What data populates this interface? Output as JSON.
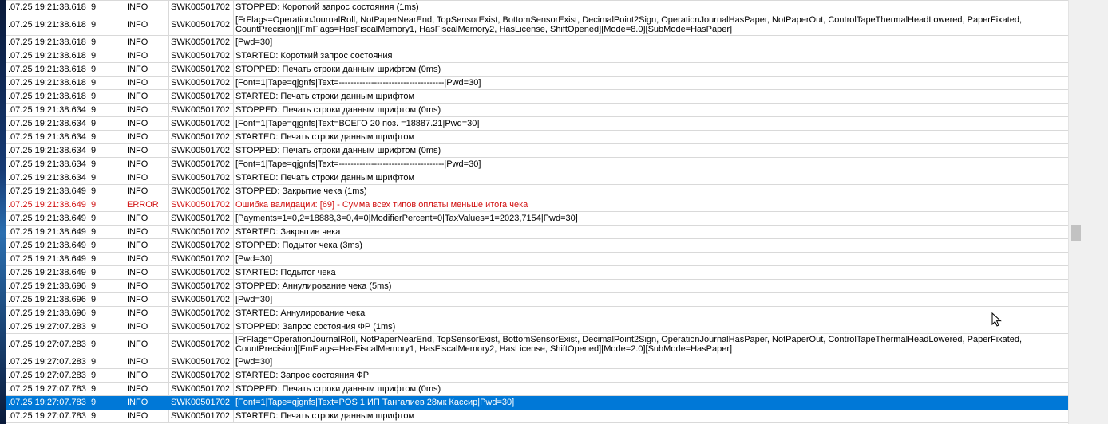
{
  "scroll": {
    "position_fraction": 0.55
  },
  "rows": [
    {
      "time": ".07.25 19:21:38.618",
      "thread": "9",
      "level": "INFO",
      "source": "SWK00501702",
      "message": "STOPPED: Короткий запрос состояния (1ms)"
    },
    {
      "time": ".07.25 19:21:38.618",
      "thread": "9",
      "level": "INFO",
      "source": "SWK00501702",
      "message": "[FrFlags=OperationJournalRoll, NotPaperNearEnd, TopSensorExist, BottomSensorExist, DecimalPoint2Sign, OperationJournalHasPaper, NotPaperOut, ControlTapeThermalHeadLowered, PaperFixated, CountPrecision][FmFlags=HasFiscalMemory1, HasFiscalMemory2, HasLicense, ShiftOpened][Mode=8.0][SubMode=HasPaper]",
      "tall": true
    },
    {
      "time": ".07.25 19:21:38.618",
      "thread": "9",
      "level": "INFO",
      "source": "SWK00501702",
      "message": "[Pwd=30]"
    },
    {
      "time": ".07.25 19:21:38.618",
      "thread": "9",
      "level": "INFO",
      "source": "SWK00501702",
      "message": "STARTED: Короткий запрос состояния"
    },
    {
      "time": ".07.25 19:21:38.618",
      "thread": "9",
      "level": "INFO",
      "source": "SWK00501702",
      "message": "STOPPED: Печать строки данным шрифтом (0ms)"
    },
    {
      "time": ".07.25 19:21:38.618",
      "thread": "9",
      "level": "INFO",
      "source": "SWK00501702",
      "message": "[Font=1|Tape=qjgnfs|Text=------------------------------------|Pwd=30]"
    },
    {
      "time": ".07.25 19:21:38.618",
      "thread": "9",
      "level": "INFO",
      "source": "SWK00501702",
      "message": "STARTED: Печать строки данным шрифтом"
    },
    {
      "time": ".07.25 19:21:38.634",
      "thread": "9",
      "level": "INFO",
      "source": "SWK00501702",
      "message": "STOPPED: Печать строки данным шрифтом (0ms)"
    },
    {
      "time": ".07.25 19:21:38.634",
      "thread": "9",
      "level": "INFO",
      "source": "SWK00501702",
      "message": "[Font=1|Tape=qjgnfs|Text=ВСЕГО 20 поз.            =18887.21|Pwd=30]"
    },
    {
      "time": ".07.25 19:21:38.634",
      "thread": "9",
      "level": "INFO",
      "source": "SWK00501702",
      "message": "STARTED: Печать строки данным шрифтом"
    },
    {
      "time": ".07.25 19:21:38.634",
      "thread": "9",
      "level": "INFO",
      "source": "SWK00501702",
      "message": "STOPPED: Печать строки данным шрифтом (0ms)"
    },
    {
      "time": ".07.25 19:21:38.634",
      "thread": "9",
      "level": "INFO",
      "source": "SWK00501702",
      "message": "[Font=1|Tape=qjgnfs|Text=------------------------------------|Pwd=30]"
    },
    {
      "time": ".07.25 19:21:38.634",
      "thread": "9",
      "level": "INFO",
      "source": "SWK00501702",
      "message": "STARTED: Печать строки данным шрифтом"
    },
    {
      "time": ".07.25 19:21:38.649",
      "thread": "9",
      "level": "INFO",
      "source": "SWK00501702",
      "message": "STOPPED: Закрытие чека (1ms)"
    },
    {
      "time": ".07.25 19:21:38.649",
      "thread": "9",
      "level": "ERROR",
      "source": "SWK00501702",
      "message": "Ошибка валидации: [69] - Сумма всех типов оплаты меньше итога чека",
      "error": true
    },
    {
      "time": ".07.25 19:21:38.649",
      "thread": "9",
      "level": "INFO",
      "source": "SWK00501702",
      "message": "[Payments=1=0,2=18888,3=0,4=0|ModifierPercent=0|TaxValues=1=2023,7154|Pwd=30]"
    },
    {
      "time": ".07.25 19:21:38.649",
      "thread": "9",
      "level": "INFO",
      "source": "SWK00501702",
      "message": "STARTED: Закрытие чека"
    },
    {
      "time": ".07.25 19:21:38.649",
      "thread": "9",
      "level": "INFO",
      "source": "SWK00501702",
      "message": "STOPPED: Подытог чека (3ms)"
    },
    {
      "time": ".07.25 19:21:38.649",
      "thread": "9",
      "level": "INFO",
      "source": "SWK00501702",
      "message": "[Pwd=30]"
    },
    {
      "time": ".07.25 19:21:38.649",
      "thread": "9",
      "level": "INFO",
      "source": "SWK00501702",
      "message": "STARTED: Подытог чека"
    },
    {
      "time": ".07.25 19:21:38.696",
      "thread": "9",
      "level": "INFO",
      "source": "SWK00501702",
      "message": "STOPPED: Аннулирование чека (5ms)"
    },
    {
      "time": ".07.25 19:21:38.696",
      "thread": "9",
      "level": "INFO",
      "source": "SWK00501702",
      "message": "[Pwd=30]"
    },
    {
      "time": ".07.25 19:21:38.696",
      "thread": "9",
      "level": "INFO",
      "source": "SWK00501702",
      "message": "STARTED: Аннулирование чека"
    },
    {
      "time": ".07.25 19:27:07.283",
      "thread": "9",
      "level": "INFO",
      "source": "SWK00501702",
      "message": "STOPPED: Запрос состояния ФР (1ms)"
    },
    {
      "time": ".07.25 19:27:07.283",
      "thread": "9",
      "level": "INFO",
      "source": "SWK00501702",
      "message": "[FrFlags=OperationJournalRoll, NotPaperNearEnd, TopSensorExist, BottomSensorExist, DecimalPoint2Sign, OperationJournalHasPaper, NotPaperOut, ControlTapeThermalHeadLowered, PaperFixated, CountPrecision][FmFlags=HasFiscalMemory1, HasFiscalMemory2, HasLicense, ShiftOpened][Mode=2.0][SubMode=HasPaper]",
      "tall": true
    },
    {
      "time": ".07.25 19:27:07.283",
      "thread": "9",
      "level": "INFO",
      "source": "SWK00501702",
      "message": "[Pwd=30]"
    },
    {
      "time": ".07.25 19:27:07.283",
      "thread": "9",
      "level": "INFO",
      "source": "SWK00501702",
      "message": "STARTED: Запрос состояния ФР"
    },
    {
      "time": ".07.25 19:27:07.783",
      "thread": "9",
      "level": "INFO",
      "source": "SWK00501702",
      "message": "STOPPED: Печать строки данным шрифтом (0ms)"
    },
    {
      "time": ".07.25 19:27:07.783",
      "thread": "9",
      "level": "INFO",
      "source": "SWK00501702",
      "message": "[Font=1|Tape=qjgnfs|Text=POS 1 ИП Тангалиев 28мк      Кассир|Pwd=30]",
      "selected": true
    },
    {
      "time": ".07.25 19:27:07.783",
      "thread": "9",
      "level": "INFO",
      "source": "SWK00501702",
      "message": "STARTED: Печать строки данным шрифтом"
    }
  ]
}
